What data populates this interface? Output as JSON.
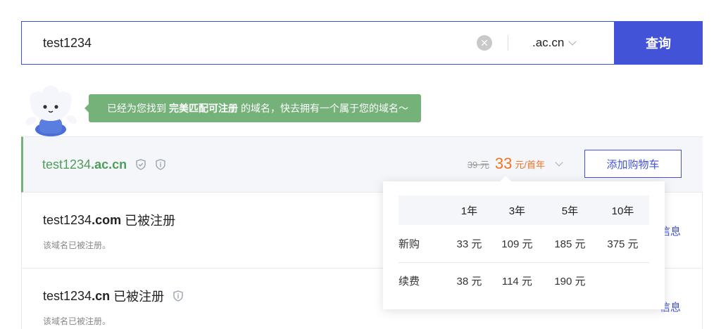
{
  "search": {
    "value": "test1234",
    "suffix": ".ac.cn",
    "button_label": "查询"
  },
  "tip": {
    "prefix": "已经为您找到",
    "highlight": "完美匹配可注册",
    "suffix": "的域名，快去拥有一个属于您的域名～"
  },
  "main_result": {
    "name": "test1234",
    "tld": ".ac.cn",
    "old_price": "39 元",
    "new_price": "33",
    "unit": "元/首年",
    "cart_label": "添加购物车"
  },
  "other_results": [
    {
      "name": "test1234",
      "tld": ".com",
      "status": "已被注册",
      "note": "该域名已被注册。",
      "link": "信息"
    },
    {
      "name": "test1234",
      "tld": ".cn",
      "status": "已被注册",
      "note": "该域名已被注册。",
      "link": "信息"
    }
  ],
  "price_table": {
    "headers": [
      "1年",
      "3年",
      "5年",
      "10年"
    ],
    "rows": [
      {
        "label": "新购",
        "values": [
          "33 元",
          "109 元",
          "185 元",
          "375 元"
        ]
      },
      {
        "label": "续费",
        "values": [
          "38 元",
          "114 元",
          "190 元",
          ""
        ]
      }
    ]
  },
  "colors": {
    "accent": "#4353d8",
    "success": "#74b27a",
    "price": "#f07422"
  }
}
